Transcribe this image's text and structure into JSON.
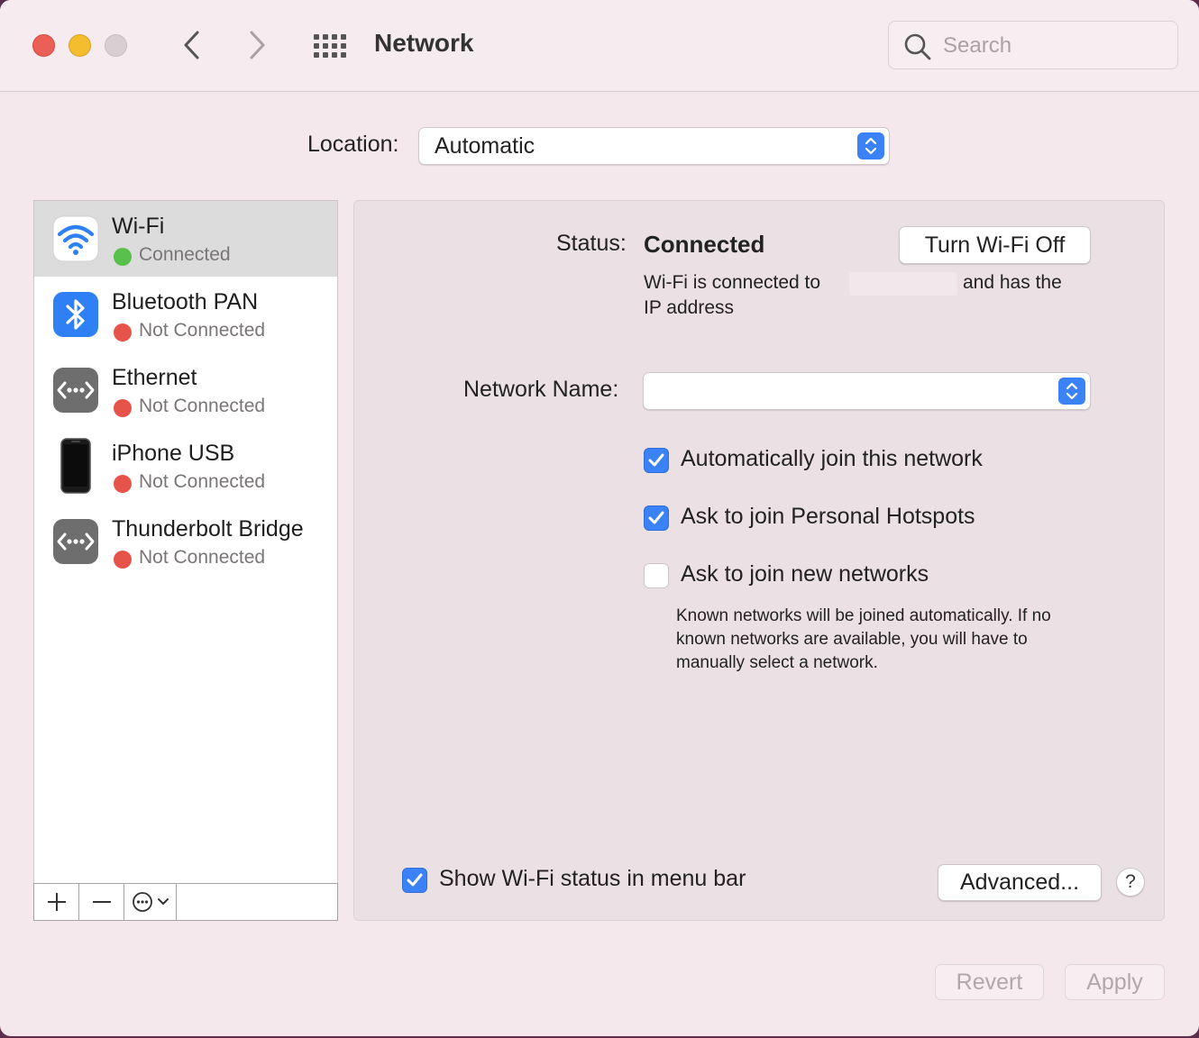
{
  "window": {
    "title": "Network",
    "search_placeholder": "Search"
  },
  "location": {
    "label": "Location:",
    "value": "Automatic"
  },
  "services": [
    {
      "name": "Wi-Fi",
      "status": "Connected",
      "status_color": "#5ac04c",
      "icon": "wifi-icon"
    },
    {
      "name": "Bluetooth PAN",
      "status": "Not Connected",
      "status_color": "#e5534b",
      "icon": "bluetooth-icon"
    },
    {
      "name": "Ethernet",
      "status": "Not Connected",
      "status_color": "#e5534b",
      "icon": "ethernet-icon"
    },
    {
      "name": "iPhone USB",
      "status": "Not Connected",
      "status_color": "#e5534b",
      "icon": "iphone-icon"
    },
    {
      "name": "Thunderbolt Bridge",
      "status": "Not Connected",
      "status_color": "#e5534b",
      "icon": "thunderbolt-bridge-icon"
    }
  ],
  "detail": {
    "status_label": "Status:",
    "status_value": "Connected",
    "turn_off_label": "Turn Wi-Fi Off",
    "desc_part1": "Wi-Fi is connected to",
    "desc_part2": "and has the",
    "desc_part3": "IP address",
    "network_name_label": "Network Name:",
    "network_name_value": "",
    "auto_join_label": "Automatically join this network",
    "auto_join_checked": true,
    "hotspot_label": "Ask to join Personal Hotspots",
    "hotspot_checked": true,
    "new_networks_label": "Ask to join new networks",
    "new_networks_checked": false,
    "help_text": "Known networks will be joined automatically. If no known networks are available, you will have to manually select a network.",
    "menubar_label": "Show Wi-Fi status in menu bar",
    "menubar_checked": true,
    "advanced_label": "Advanced...",
    "help_label": "?"
  },
  "footer": {
    "revert_label": "Revert",
    "apply_label": "Apply"
  },
  "colors": {
    "accent": "#3b82f6",
    "connected": "#5ac04c",
    "not_connected": "#e5534b"
  }
}
